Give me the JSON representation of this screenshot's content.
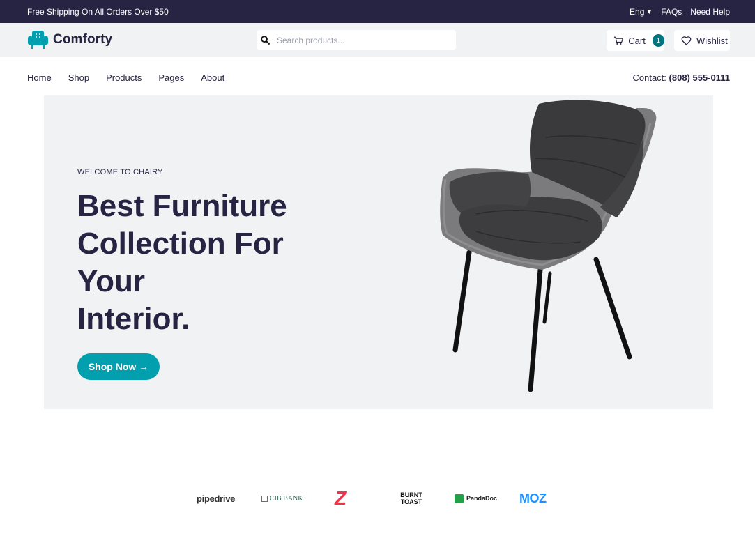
{
  "topbar": {
    "promo": "Free Shipping On All Orders Over $50",
    "language": "Eng",
    "faqs": "FAQs",
    "help": "Need Help"
  },
  "header": {
    "brand": "Comforty",
    "search_placeholder": "Search products...",
    "cart_label": "Cart",
    "cart_count": "1",
    "wishlist_label": "Wishlist"
  },
  "nav": {
    "items": [
      "Home",
      "Shop",
      "Products",
      "Pages",
      "About"
    ],
    "contact_label": "Contact:",
    "contact_phone": "(808) 555-0111"
  },
  "hero": {
    "eyebrow": "WELCOME TO CHAIRY",
    "headline_lines": [
      "Best Furniture",
      "Collection For",
      "Your",
      "Interior."
    ],
    "cta": "Shop Now →"
  },
  "partners": [
    "pipedrive",
    "CIB BANK",
    "Z",
    "BURNT TOAST",
    "PandaDoc",
    "MOZ"
  ],
  "colors": {
    "dark": "#272343",
    "accent": "#029fae",
    "badge": "#007580",
    "panel": "#f0f2f3"
  },
  "icons": {
    "logo": "armchair-icon",
    "search": "search-icon",
    "cart": "cart-icon",
    "wishlist": "heart-icon",
    "lang_caret": "caret-down-icon"
  }
}
